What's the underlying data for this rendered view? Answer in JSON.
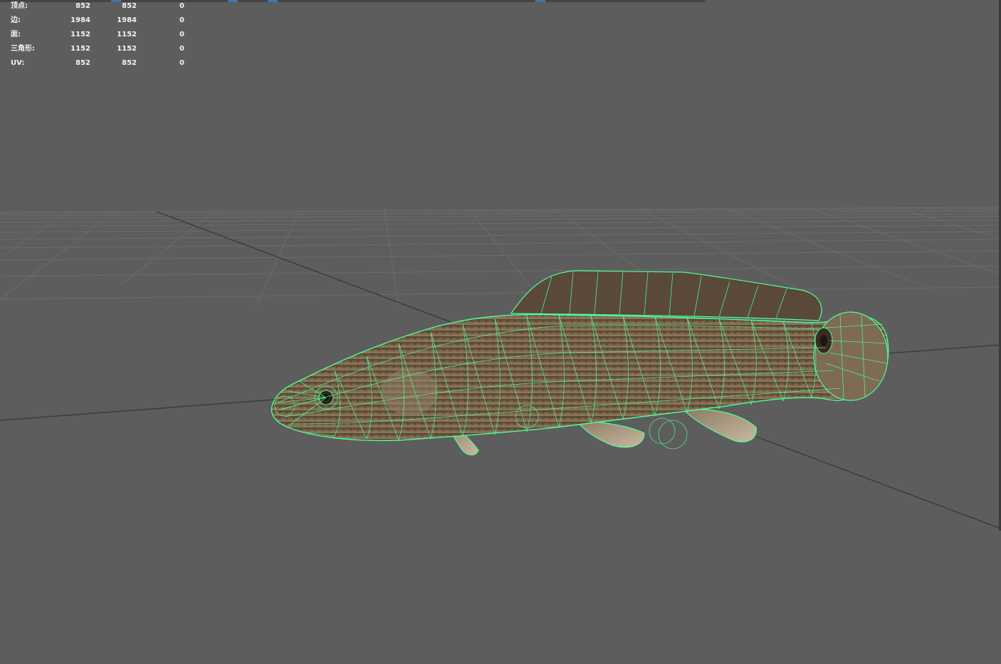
{
  "hud": {
    "rows": [
      {
        "label": "顶点:",
        "v1": "852",
        "v2": "852",
        "v3": "0"
      },
      {
        "label": "边:",
        "v1": "1984",
        "v2": "1984",
        "v3": "0"
      },
      {
        "label": "面:",
        "v1": "1152",
        "v2": "1152",
        "v3": "0"
      },
      {
        "label": "三角形:",
        "v1": "1152",
        "v2": "1152",
        "v3": "0"
      },
      {
        "label": "UV:",
        "v1": "852",
        "v2": "852",
        "v3": "0"
      }
    ]
  },
  "colors": {
    "background": "#5d5d5d",
    "grid": "#6e6e6e",
    "grid_axis": "#3c3c3c",
    "wireframe": "#4dff9a",
    "fish_body": "#6b5540",
    "toolbar_active": "#3f77a8"
  },
  "viewport": {
    "object": "fish-mesh",
    "display_mode": "wireframe-on-shaded"
  }
}
